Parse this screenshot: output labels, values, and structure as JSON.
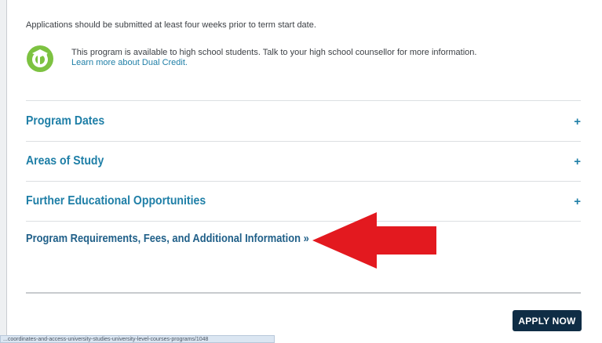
{
  "notices": {
    "submit_note": "Applications should be submitted at least four weeks prior to term start date.",
    "dual_credit_text": "This program is available to high school students. Talk to your high school counsellor for more information.",
    "dual_credit_link": "Learn more about Dual Credit."
  },
  "accordion": {
    "items": [
      {
        "label": "Program Dates",
        "icon": "+"
      },
      {
        "label": "Areas of Study",
        "icon": "+"
      },
      {
        "label": "Further Educational Opportunities",
        "icon": "+"
      }
    ]
  },
  "requirements_link": "Program Requirements, Fees, and Additional Information »",
  "apply_button": "APPLY NOW",
  "status_url": "...coordinates-and-access-university-studies-university-level-courses-programs/1048",
  "colors": {
    "accent_teal": "#1f7fa7",
    "button_navy": "#0f2d45",
    "badge_green": "#7dc241",
    "annotation_red": "#e3191f"
  },
  "icons": {
    "dual_credit": "dual-credit-graduation-badge-icon",
    "annotation": "red-left-arrow"
  }
}
